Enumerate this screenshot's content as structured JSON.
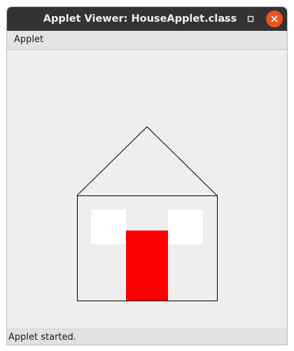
{
  "window": {
    "title": "Applet Viewer: HouseApplet.class"
  },
  "menubar": {
    "items": [
      {
        "label": "Applet"
      }
    ]
  },
  "status": {
    "text": "Applet started."
  },
  "drawing": {
    "roof_stroke": "#000000",
    "walls_stroke": "#000000",
    "window_fill": "#ffffff",
    "door_fill": "#ff0000"
  },
  "colors": {
    "titlebar": "#333333",
    "close_button": "#e95420",
    "canvas_background": "#eeeeee"
  }
}
